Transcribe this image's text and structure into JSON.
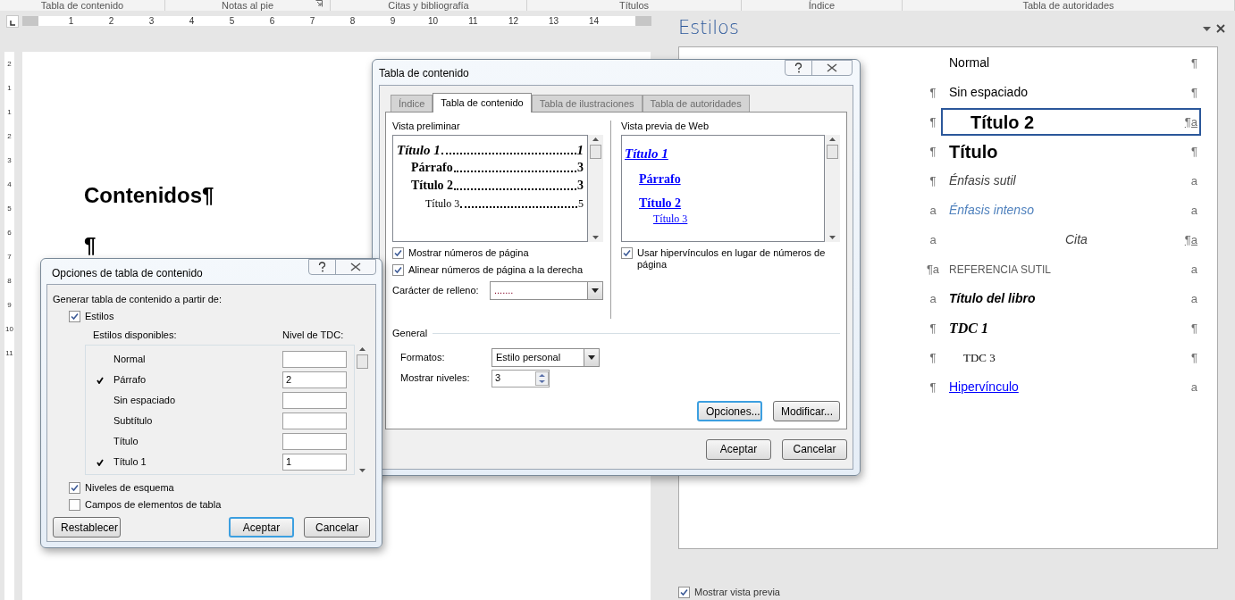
{
  "ribbon_groups": [
    {
      "label": "Tabla de contenido",
      "launcher": false
    },
    {
      "label": "Notas al pie",
      "launcher": true
    },
    {
      "label": "Citas y bibliografía",
      "launcher": false
    },
    {
      "label": "Títulos",
      "launcher": false
    },
    {
      "label": "Índice",
      "launcher": false
    },
    {
      "label": "Tabla de autoridades",
      "launcher": false
    }
  ],
  "ruler": {
    "numbers": [
      "1",
      "2",
      "3",
      "4",
      "5",
      "6",
      "7",
      "8",
      "9",
      "10",
      "11",
      "12",
      "13",
      "14"
    ]
  },
  "vertical_ruler": {
    "numbers": [
      "2",
      "1",
      "1",
      "2",
      "3",
      "4",
      "5",
      "6",
      "7",
      "8",
      "9",
      "10",
      "11"
    ]
  },
  "document": {
    "heading": "Contenidos¶",
    "paragraph_mark": "¶"
  },
  "styles_pane": {
    "title": "Estilos",
    "items": [
      {
        "name": "Normal",
        "kind": "normal",
        "right_mark": "¶",
        "selected": false
      },
      {
        "name": "Sin espaciado",
        "kind": "normal",
        "left_mark": "¶",
        "right_mark": "¶",
        "selected": false
      },
      {
        "name": "Título 2",
        "kind": "heading2",
        "left_mark": "¶",
        "right_mark": "¶a",
        "selected": true
      },
      {
        "name": "Título",
        "kind": "title",
        "left_mark": "¶",
        "right_mark": "¶",
        "selected": false
      },
      {
        "name": "Énfasis sutil",
        "kind": "subtle_emphasis",
        "left_mark": "¶",
        "right_mark": "a",
        "selected": false
      },
      {
        "name": "Énfasis intenso",
        "kind": "intense_emphasis",
        "left_mark": "a",
        "right_mark": "a",
        "selected": false
      },
      {
        "name": "Cita",
        "kind": "quote",
        "left_mark": "a",
        "right_mark": "¶a",
        "selected": false
      },
      {
        "name": "REFERENCIA SUTIL",
        "kind": "subtle_reference",
        "left_mark": "¶a",
        "right_mark": "a",
        "selected": false
      },
      {
        "name": "Título del libro",
        "kind": "book_title",
        "left_mark": "a",
        "right_mark": "a",
        "selected": false
      },
      {
        "name": "TDC 1",
        "kind": "toc1",
        "left_mark": "¶",
        "right_mark": "¶",
        "selected": false
      },
      {
        "name": "TDC 3",
        "kind": "toc3",
        "left_mark": "¶",
        "right_mark": "¶",
        "selected": false
      },
      {
        "name": "Hipervínculo",
        "kind": "hyperlink",
        "left_mark": "¶",
        "right_mark": "a",
        "selected": false
      }
    ],
    "show_preview": {
      "label": "Mostrar vista previa",
      "checked": true
    }
  },
  "toc_dialog": {
    "title": "Tabla de contenido",
    "tabs": [
      {
        "label": "Índice",
        "selected": false
      },
      {
        "label": "Tabla de contenido",
        "selected": true
      },
      {
        "label": "Tabla de ilustraciones",
        "selected": false
      },
      {
        "label": "Tabla de autoridades",
        "selected": false
      }
    ],
    "print_preview": {
      "label": "Vista preliminar",
      "entries": [
        {
          "text": "Título 1",
          "page": "1",
          "kind": "toc1"
        },
        {
          "text": "Párrafo",
          "page": "3",
          "kind": "toc2"
        },
        {
          "text": "Título 2",
          "page": "3",
          "kind": "toc2"
        },
        {
          "text": "Título 3",
          "page": "5",
          "kind": "toc3"
        }
      ]
    },
    "print_options": [
      {
        "label": "Mostrar números de página",
        "checked": true
      },
      {
        "label": "Alinear números de página a la derecha",
        "checked": true
      }
    ],
    "fill_char": {
      "label": "Carácter de relleno:",
      "value": "......."
    },
    "web_preview": {
      "label": "Vista previa de Web",
      "entries": [
        {
          "text": "Título 1",
          "kind": "toc1"
        },
        {
          "text": "Párrafo",
          "kind": "toc2"
        },
        {
          "text": "Título 2",
          "kind": "toc2"
        },
        {
          "text": "Título 3",
          "kind": "toc3"
        }
      ]
    },
    "web_option": {
      "label": "Usar hipervínculos en lugar de números de página",
      "checked": true
    },
    "general": {
      "label": "General",
      "formats": {
        "label": "Formatos:",
        "value": "Estilo personal"
      },
      "levels": {
        "label": "Mostrar niveles:",
        "value": "3"
      }
    },
    "options_button": "Opciones...",
    "modify_button": "Modificar...",
    "ok_button": "Aceptar",
    "cancel_button": "Cancelar"
  },
  "options_dialog": {
    "title": "Opciones de tabla de contenido",
    "intro": "Generar tabla de contenido a partir de:",
    "styles_option": {
      "label": "Estilos",
      "checked": true
    },
    "available_label": "Estilos disponibles:",
    "level_label": "Nivel de TDC:",
    "rows": [
      {
        "name": "Normal",
        "checked": false
      },
      {
        "name": "Párrafo",
        "checked": true,
        "level": "2"
      },
      {
        "name": "Sin espaciado",
        "checked": false
      },
      {
        "name": "Subtítulo",
        "checked": false
      },
      {
        "name": "Título",
        "checked": false
      },
      {
        "name": "Título 1",
        "checked": true,
        "level": "1"
      }
    ],
    "outline_option": {
      "label": "Niveles de esquema",
      "checked": true
    },
    "fields_option": {
      "label": "Campos de elementos de tabla",
      "checked": false
    },
    "reset_button": "Restablecer",
    "ok_button": "Aceptar",
    "cancel_button": "Cancelar"
  }
}
